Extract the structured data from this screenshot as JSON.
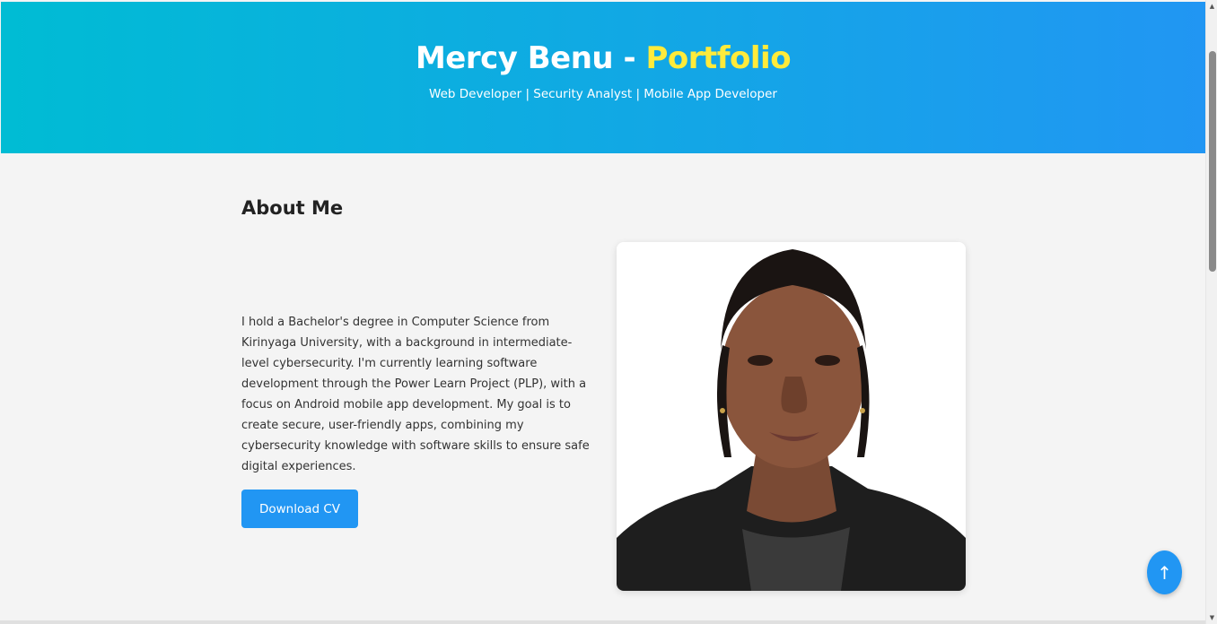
{
  "header": {
    "title_name": "Mercy Benu - ",
    "title_accent": "Portfolio",
    "subtitle": "Web Developer | Security Analyst | Mobile App Developer"
  },
  "about": {
    "heading": "About Me",
    "text": "I hold a Bachelor's degree in Computer Science from Kirinyaga University, with a background in intermediate-level cybersecurity. I'm currently learning software development through the Power Learn Project (PLP), with a focus on Android mobile app development. My goal is to create secure, user-friendly apps, combining my cybersecurity knowledge with software skills to ensure safe digital experiences.",
    "cv_button_label": "Download CV"
  },
  "scroll_top": {
    "icon": "arrow-up-icon",
    "glyph": "↑"
  },
  "colors": {
    "gradient_start": "#00bcd4",
    "gradient_end": "#2196f3",
    "accent_yellow": "#ffeb3b",
    "button_blue": "#2196f3",
    "background": "#f4f4f4"
  }
}
